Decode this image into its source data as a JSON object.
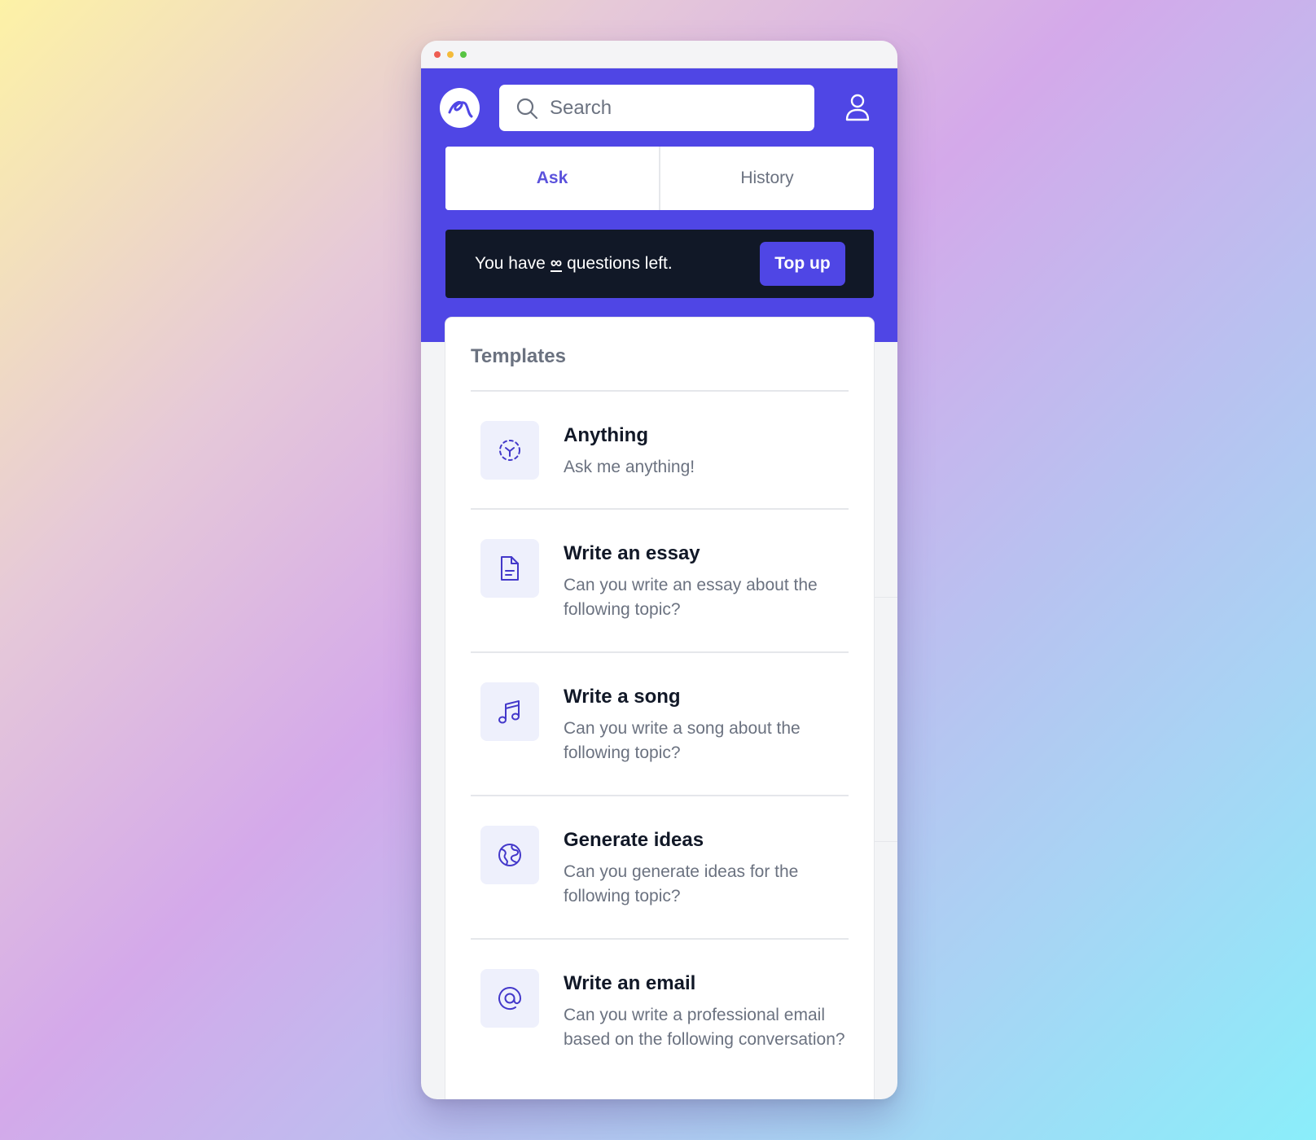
{
  "window": {
    "controls": [
      "close",
      "minimize",
      "zoom"
    ]
  },
  "header": {
    "logo_icon": "scribble-logo-icon",
    "search": {
      "placeholder": "Search",
      "icon": "search-icon"
    },
    "profile_icon": "user-icon"
  },
  "tabs": [
    {
      "label": "Ask",
      "active": true
    },
    {
      "label": "History",
      "active": false
    }
  ],
  "banner": {
    "prefix": "You have",
    "quota": "∞",
    "suffix": "questions left.",
    "button_label": "Top up"
  },
  "templates": {
    "title": "Templates",
    "items": [
      {
        "title": "Anything",
        "description": "Ask me anything!",
        "icon": "scan-face-icon"
      },
      {
        "title": "Write an essay",
        "description": "Can you write an essay about the following topic?",
        "icon": "document-icon"
      },
      {
        "title": "Write a song",
        "description": "Can you write a song about the following topic?",
        "icon": "music-note-icon"
      },
      {
        "title": "Generate ideas",
        "description": "Can you generate ideas for the following topic?",
        "icon": "globe-icon"
      },
      {
        "title": "Write an email",
        "description": "Can you write a professional email based on the following conversation?",
        "icon": "at-sign-icon"
      }
    ]
  },
  "colors": {
    "brand": "#4f46e5",
    "banner_bg": "#111827",
    "icon_tile_bg": "#eef0fc",
    "active_tab_text": "#5b52dc"
  }
}
